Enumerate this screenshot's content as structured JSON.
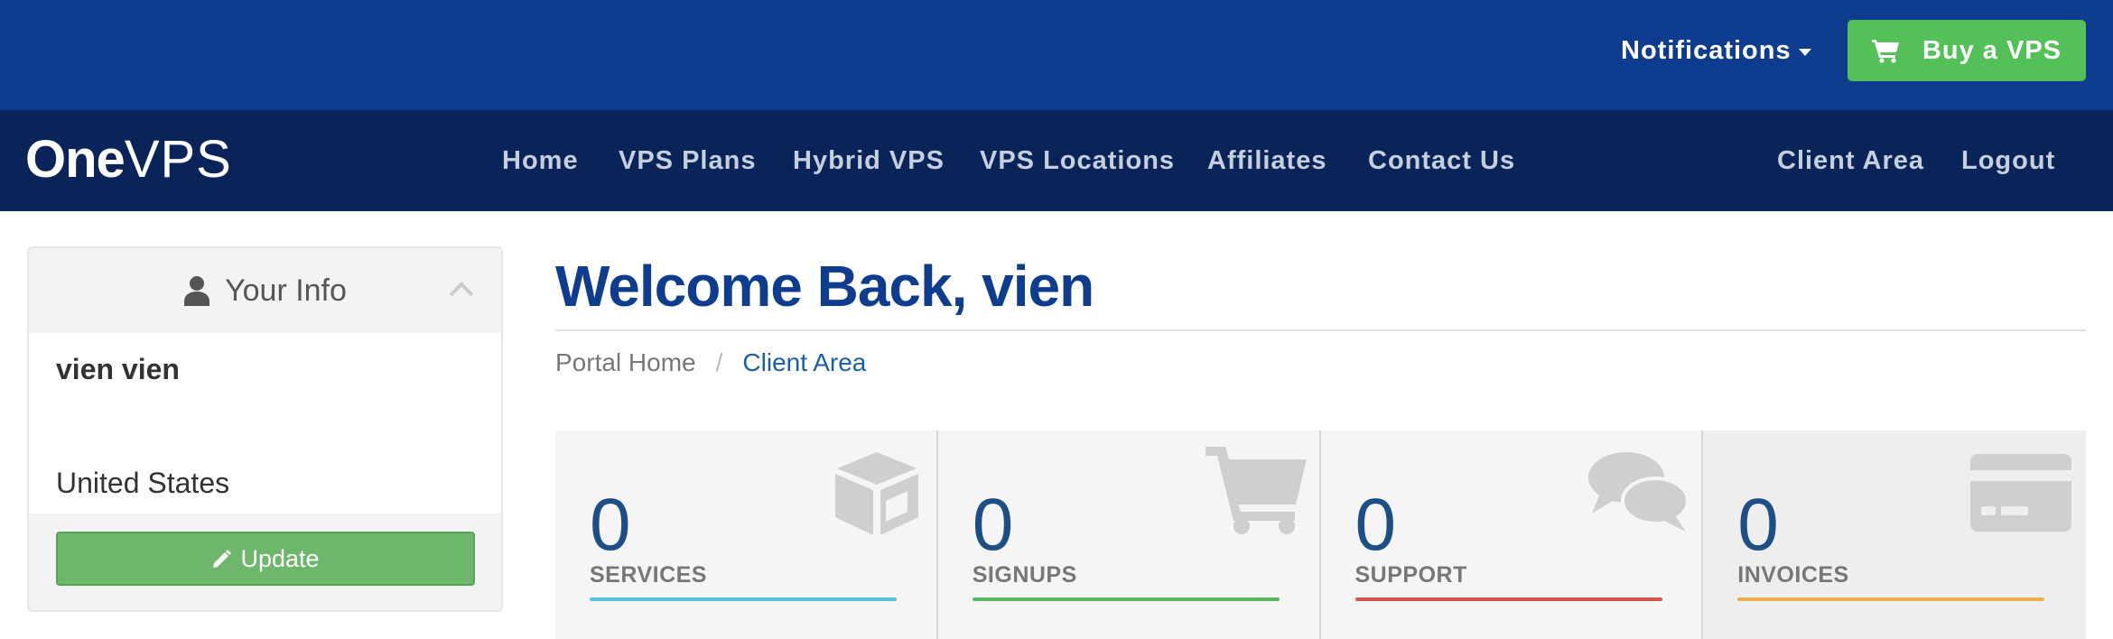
{
  "topbar": {
    "notifications_label": "Notifications",
    "buy_label": "Buy a VPS"
  },
  "logo": {
    "part1": "One",
    "part2": "VPS"
  },
  "nav": {
    "items": [
      "Home",
      "VPS Plans",
      "Hybrid VPS",
      "VPS Locations",
      "Affiliates",
      "Contact Us"
    ],
    "client_area": "Client Area",
    "logout": "Logout"
  },
  "sidebar": {
    "title": "Your Info",
    "name": "vien vien",
    "country": "United States",
    "update_label": "Update"
  },
  "main": {
    "welcome": "Welcome Back, vien",
    "breadcrumb": {
      "home": "Portal Home",
      "separator": "/",
      "current": "Client Area"
    }
  },
  "tiles": [
    {
      "count": "0",
      "label": "SERVICES",
      "icon": "cube-icon",
      "color": "#5bc0de"
    },
    {
      "count": "0",
      "label": "SIGNUPS",
      "icon": "shopping-cart-icon",
      "color": "#5cb85c"
    },
    {
      "count": "0",
      "label": "SUPPORT",
      "icon": "comments-icon",
      "color": "#d9534f"
    },
    {
      "count": "0",
      "label": "INVOICES",
      "icon": "credit-card-icon",
      "color": "#f0ad4e"
    }
  ],
  "colors": {
    "topbar": "#0e3d8f",
    "navbar": "#0a2459",
    "buy_button": "#53c158",
    "update_button": "#6db66b",
    "heading": "#0e3d8f"
  }
}
